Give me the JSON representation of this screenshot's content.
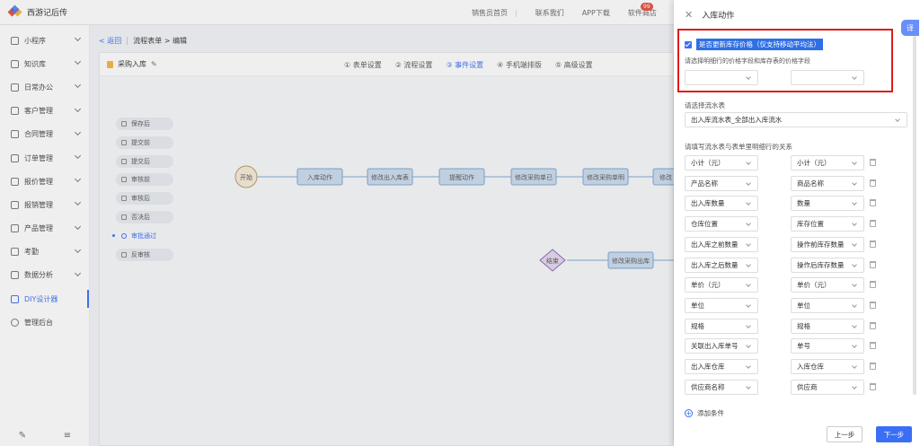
{
  "app": {
    "title": "西游记后传"
  },
  "top_links": [
    "销售员首页",
    "联系我们",
    "APP下载",
    "软件商店"
  ],
  "top_badge": "99",
  "sidebar": {
    "items": [
      {
        "label": "小程序"
      },
      {
        "label": "知识库"
      },
      {
        "label": "日常办公"
      },
      {
        "label": "客户管理"
      },
      {
        "label": "合同管理"
      },
      {
        "label": "订单管理"
      },
      {
        "label": "报价管理"
      },
      {
        "label": "报销管理"
      },
      {
        "label": "产品管理"
      },
      {
        "label": "考勤"
      },
      {
        "label": "数据分析"
      },
      {
        "label": "DIY设计器"
      },
      {
        "label": "管理后台"
      }
    ],
    "active_index": 11
  },
  "breadcrumb": {
    "back": "< 返回",
    "path": "流程表单 > 编辑"
  },
  "form_name": "采购入库",
  "steps": [
    "① 表单设置",
    "② 流程设置",
    "③ 事件设置",
    "④ 手机端排版",
    "⑤ 高级设置"
  ],
  "events": [
    "保存后",
    "提交前",
    "提交后",
    "审核前",
    "审核后",
    "否决后",
    "审批通过",
    "反审核"
  ],
  "flow_nodes": {
    "start": "开始",
    "end": "结束",
    "row1": [
      "入库动作",
      "修改出入库表",
      "提醒动作",
      "修改采购单已",
      "修改采购单明",
      "修改"
    ],
    "row2": [
      "修改采购出库"
    ]
  },
  "panel": {
    "title": "入库动作",
    "translate": "译",
    "checkbox_label": "是否更新库存价格（仅支持移动平均法）",
    "hint": "请选择明细行的价格字段和库存表的价格字段",
    "flow_table_label": "请选择流水表",
    "flow_table_value": "出入库流水表_全部出入库流水",
    "relation_label": "请填写流水表与表单里明细行的关系",
    "relations": [
      {
        "left": "小计（元）",
        "right": "小计（元）"
      },
      {
        "left": "产品名称",
        "right": "商品名称"
      },
      {
        "left": "出入库数量",
        "right": "数量"
      },
      {
        "left": "仓库位置",
        "right": "库存位置"
      },
      {
        "left": "出入库之前数量",
        "right": "操作前库存数量"
      },
      {
        "left": "出入库之后数量",
        "right": "操作后库存数量"
      },
      {
        "left": "单价（元）",
        "right": "单价（元）"
      },
      {
        "left": "单位",
        "right": "单位"
      },
      {
        "left": "规格",
        "right": "规格"
      },
      {
        "left": "关联出入库单号",
        "right": "单号"
      },
      {
        "left": "出入库仓库",
        "right": "入库仓库"
      },
      {
        "left": "供应商名称",
        "right": "供应商"
      }
    ],
    "add_condition": "添加条件",
    "prev": "上一步",
    "next": "下一步"
  },
  "colors": {
    "accent": "#3a6ff5",
    "highlight": "#e11b1b"
  }
}
